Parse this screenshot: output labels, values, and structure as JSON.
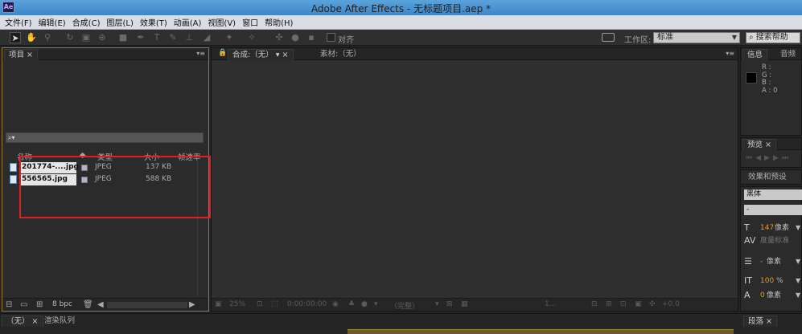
{
  "window": {
    "app_icon": "Ae",
    "title": "Adobe After Effects - 无标题项目.aep *"
  },
  "menu": [
    "文件(F)",
    "编辑(E)",
    "合成(C)",
    "图层(L)",
    "效果(T)",
    "动画(A)",
    "视图(V)",
    "窗口",
    "帮助(H)"
  ],
  "toolbar": {
    "align_label": "对齐",
    "workspace_label": "工作区:",
    "workspace_value": "标准",
    "search_help": "搜索帮助"
  },
  "project_panel": {
    "tab": "项目",
    "search_placeholder": "⌕▾",
    "columns": {
      "name": "名称",
      "type": "类型",
      "size": "大小",
      "framerate": "帧速率"
    },
    "files": [
      {
        "name": "201774-....jpg",
        "type": "JPEG",
        "size": "137 KB"
      },
      {
        "name": "556565.jpg",
        "type": "JPEG",
        "size": "588 KB"
      }
    ],
    "bpc": "8 bpc"
  },
  "comp_panel": {
    "tab": "合成:（无）",
    "footage_tab": "素材:（无）",
    "zoom": "25%",
    "timecode": "0:00:00:00",
    "view": "（完整）",
    "views": "1...",
    "exposure": "+0.0"
  },
  "info_panel": {
    "tab": "信息",
    "audio_tab": "音频",
    "r": "R :",
    "g": "G :",
    "b": "B :",
    "a": "A : 0"
  },
  "preview_panel": {
    "tab": "预览"
  },
  "effects_panel": {
    "tab": "效果和预设"
  },
  "character_panel": {
    "font": "黑体",
    "style": "-",
    "size": {
      "value": "147",
      "unit": "像素"
    },
    "tracking_label": "度量标准",
    "stroke": {
      "value": "-",
      "unit": "像素"
    },
    "vscale": {
      "value": "100",
      "unit": "%"
    },
    "baseline": {
      "value": "0",
      "unit": "像素"
    }
  },
  "bottom": {
    "tab1": "（无）",
    "tab2": "渲染队列",
    "paragraph_tab": "段落"
  },
  "colors": {
    "accent_title": "#3f86c8",
    "highlight": "#e02020",
    "orange_value": "#e09a2b"
  }
}
